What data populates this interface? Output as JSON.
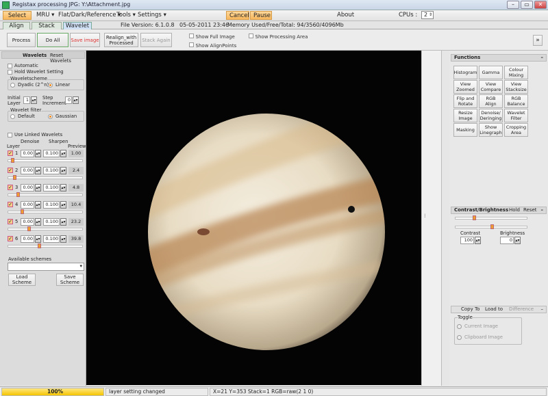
{
  "window": {
    "title": "Registax processing JPG: Y:\\Attachment.jpg",
    "btn_min": "–",
    "btn_max": "▭",
    "btn_close": "✕"
  },
  "menu": {
    "select": "Select",
    "mru": "MRU ▾",
    "flat": "Flat/Dark/Reference ▾",
    "tools": "Tools ▾",
    "settings": "Settings ▾",
    "cancel": "Cancel",
    "pause": "Pause",
    "about": "About",
    "cpus_label": "CPUs :",
    "cpus_value": "2"
  },
  "tabs": {
    "align": "Align",
    "stack": "Stack",
    "wavelet": "Wavelet",
    "file_version": "File Version: 6.1.0.8",
    "date": "05-05-2011 23:46",
    "memory": "Memory Used/Free/Total: 94/3560/4096Mb"
  },
  "toolbar": {
    "process": "Process",
    "do_all": "Do All",
    "save_image": "Save image",
    "realign_1": "Realign_with",
    "realign_2": "Processed",
    "stack_again": "Stack Again",
    "show_full": "Show Full Image",
    "show_align": "Show AlignPoints",
    "show_processing": "Show Processing Area",
    "expand": "»"
  },
  "wavelets": {
    "title": "Wavelets",
    "reset": "Reset Wavelets",
    "automatic": "Automatic",
    "hold": "Hold Wavelet Setting",
    "scheme_label": "Waveletscheme",
    "dyadic": "Dyadic (2^n)",
    "linear": "Linear",
    "initial_1": "Initial",
    "initial_2": "Layer",
    "initial_value": "1",
    "step_1": "Step",
    "step_2": "Increment",
    "step_value": "0",
    "filter_label": "Wavelet filter",
    "default": "Default",
    "gaussian": "Gaussian",
    "use_linked": "Use Linked Wavelets",
    "col_layer": "Layer",
    "col_denoise": "Denoise",
    "col_sharpen": "Sharpen",
    "col_preview": "Preview",
    "layers": [
      {
        "n": "1",
        "denoise": "0.00",
        "sharpen": "0.100",
        "preview": "1.00",
        "slider": 0.05
      },
      {
        "n": "2",
        "denoise": "0.00",
        "sharpen": "0.100",
        "preview": "2.4",
        "slider": 0.08
      },
      {
        "n": "3",
        "denoise": "0.00",
        "sharpen": "0.100",
        "preview": "4.8",
        "slider": 0.12
      },
      {
        "n": "4",
        "denoise": "0.00",
        "sharpen": "0.100",
        "preview": "10.4",
        "slider": 0.18
      },
      {
        "n": "5",
        "denoise": "0.00",
        "sharpen": "0.100",
        "preview": "23.2",
        "slider": 0.28
      },
      {
        "n": "6",
        "denoise": "0.00",
        "sharpen": "0.100",
        "preview": "39.8",
        "slider": 0.42
      }
    ],
    "available": "Available schemes",
    "load_1": "Load",
    "load_2": "Scheme",
    "save_1": "Save",
    "save_2": "Scheme"
  },
  "functions": {
    "title": "Functions",
    "collapse": "–",
    "buttons": [
      [
        "Histogram",
        ""
      ],
      [
        "Gamma",
        ""
      ],
      [
        "Colour",
        "Mixing"
      ],
      [
        "View",
        "Zoomed"
      ],
      [
        "View",
        "Compare"
      ],
      [
        "View",
        "Stacksize"
      ],
      [
        "Flip and",
        "Rotate"
      ],
      [
        "RGB",
        "Align"
      ],
      [
        "RGB",
        "Balance"
      ],
      [
        "Resize",
        "Image"
      ],
      [
        "Denoise/",
        "Deringing"
      ],
      [
        "Wavelet",
        "Filter"
      ],
      [
        "Masking",
        ""
      ],
      [
        "Show",
        "Linegraph"
      ],
      [
        "Cropping",
        "Area"
      ]
    ]
  },
  "contrast": {
    "title": "Contrast/Brightness",
    "hold": "Hold",
    "reset": "Reset",
    "contrast": "Contrast",
    "contrast_value": "100",
    "brightness": "Brightness",
    "brightness_value": "0",
    "slider1": 0.25,
    "slider2": 0.5
  },
  "copy": {
    "copy_to": "Copy To",
    "load_to": "Load to",
    "difference": "Difference",
    "toggle": "Toggle",
    "current": "Current Image",
    "clipboard": "Clipboard Image"
  },
  "status": {
    "progress": "100%",
    "progress_value": 1.0,
    "message": "layer setting changed",
    "info": "X=21 Y=353 Stack=1 RGB=raw(2 1 0)"
  }
}
